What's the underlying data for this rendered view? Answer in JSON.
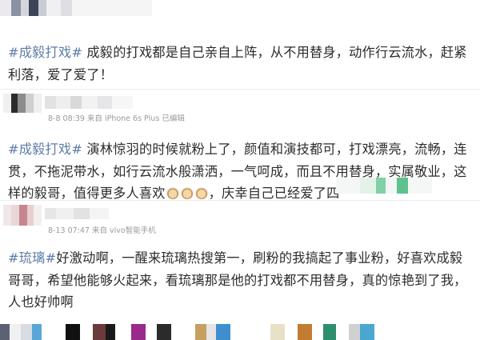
{
  "posts": [
    {
      "tag": "#成毅打戏#",
      "text": " 成毅的打戏都是自己亲自上阵，从不用替身，动作行云流水，赶紧利落，爱了爱了！",
      "meta": null
    },
    {
      "tag": "#成毅打戏#",
      "text": " 演林惊羽的时候就粉上了，颜值和演技都可，打戏漂亮，流畅，连贯，不拖泥带水，如行云流水般潇洒，一气呵成，而且不用替身，实属敬业，这样的毅哥，值得更多人喜欢",
      "text_tail": "，庆幸自己已经爱了四",
      "meta": "8-8 08:39 来自 iPhone 6s Plus 已编辑"
    },
    {
      "tag": "#琉璃#",
      "text": "好激动啊，一醒来琉璃热搜第一，刷粉的我搞起了事业粉，好喜欢成毅哥哥，希望他能够火起来，看琉璃那是他的打戏都不用替身，真的惊艳到了我，人也好帅啊",
      "meta": "8-13 07:47 来自 vivo智能手机"
    }
  ],
  "emoji_icons": [
    "dog-face-icon",
    "dog-face-icon",
    "dog-face-icon"
  ],
  "colors": {
    "tag": "#5e7ca8",
    "body_text": "#2b2b2b",
    "meta_text": "#9a9a9a"
  }
}
